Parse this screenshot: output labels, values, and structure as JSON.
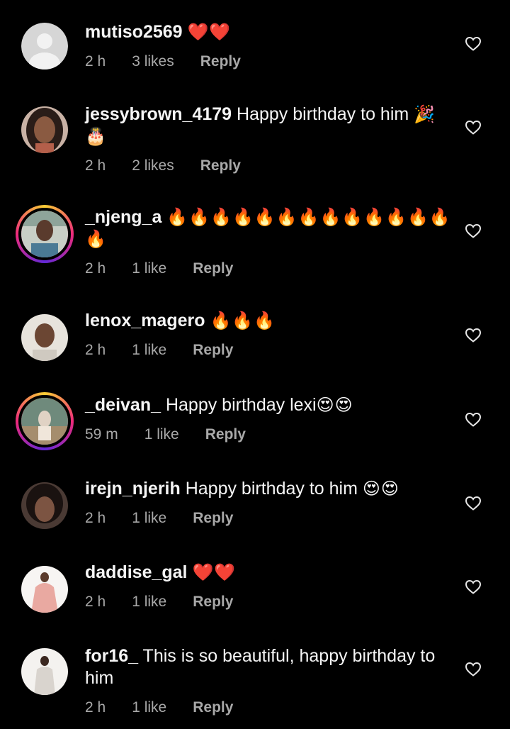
{
  "comments": [
    {
      "username": "mutiso2569",
      "text": "",
      "emoji": "❤️❤️",
      "time": "2 h",
      "likes": "3 likes",
      "reply": "Reply"
    },
    {
      "username": "jessybrown_4179",
      "text": "Happy birthday to him",
      "emoji": "🎉🎂",
      "time": "2 h",
      "likes": "2 likes",
      "reply": "Reply"
    },
    {
      "username": "_njeng_a",
      "text": "",
      "emoji": "🔥🔥🔥🔥🔥🔥🔥🔥🔥🔥🔥🔥🔥🔥",
      "time": "2 h",
      "likes": "1 like",
      "reply": "Reply"
    },
    {
      "username": "lenox_magero",
      "text": "",
      "emoji": "🔥🔥🔥",
      "time": "2 h",
      "likes": "1 like",
      "reply": "Reply"
    },
    {
      "username": "_deivan_",
      "text": "Happy birthday lexi",
      "emoji": "😍😍",
      "time": "59 m",
      "likes": "1 like",
      "reply": "Reply"
    },
    {
      "username": "irejn_njerih",
      "text": "Happy birthday to him",
      "emoji": "😍😍",
      "time": "2 h",
      "likes": "1 like",
      "reply": "Reply"
    },
    {
      "username": "daddise_gal",
      "text": "",
      "emoji": "❤️❤️",
      "time": "2 h",
      "likes": "1 like",
      "reply": "Reply"
    },
    {
      "username": "for16_",
      "text": "This is so beautiful, happy birthday to him",
      "emoji": "",
      "time": "2 h",
      "likes": "1 like",
      "reply": "Reply"
    }
  ],
  "icons": {
    "like": "heart-outline-icon"
  },
  "colors": {
    "background": "#000000",
    "text": "#f5f5f5",
    "secondary": "#a8a8a8"
  }
}
